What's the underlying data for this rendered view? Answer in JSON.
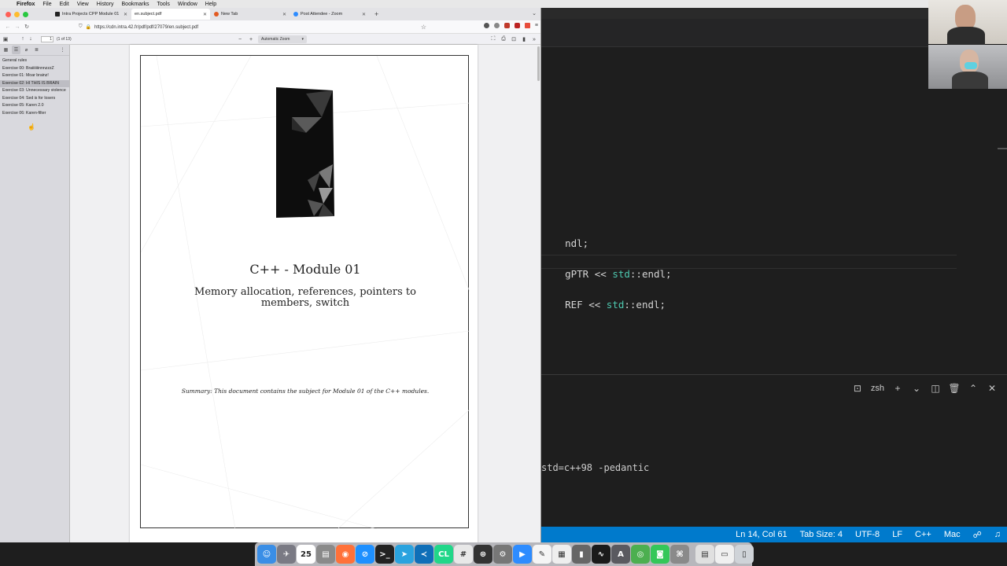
{
  "menubar": {
    "app_name": "Firefox",
    "items": [
      "File",
      "Edit",
      "View",
      "History",
      "Bookmarks",
      "Tools",
      "Window",
      "Help"
    ]
  },
  "browser": {
    "tabs": [
      {
        "label": "Intra Projects CPP Module 01",
        "active": false,
        "icon_color": "#222222"
      },
      {
        "label": "en.subject.pdf",
        "active": true,
        "icon_color": "#ffffff"
      },
      {
        "label": "New Tab",
        "active": false,
        "icon_color": "#e25920"
      },
      {
        "label": "Post Attendee - Zoom",
        "active": false,
        "icon_color": "#2d8cff"
      }
    ],
    "new_tab_label": "+",
    "url": "https://cdn.intra.42.fr/pdf/pdf/27079/en.subject.pdf"
  },
  "pdf_viewer": {
    "page_number": "1",
    "page_count": "(1 of 13)",
    "zoom_level": "Automatic Zoom",
    "outline": [
      {
        "label": "General rules",
        "highlighted": false
      },
      {
        "label": "Exercise 00: BraiiiiiiinnnzzzZ",
        "highlighted": false
      },
      {
        "label": "Exercise 01: Moar brainz!",
        "highlighted": false
      },
      {
        "label": "Exercise 02: HI THIS IS BRAIN",
        "highlighted": true
      },
      {
        "label": "Exercise 03: Unnecessary violence",
        "highlighted": false
      },
      {
        "label": "Exercise 04: Sed is for losers",
        "highlighted": false
      },
      {
        "label": "Exercise 05: Karen 2.0",
        "highlighted": false
      },
      {
        "label": "Exercise 06: Karen-filter",
        "highlighted": false
      }
    ],
    "document": {
      "title": "C++ - Module 01",
      "subtitle": "Memory allocation, references, pointers to members, switch",
      "summary": "Summary:  This document contains the subject for Module 01 of the C++ modules."
    }
  },
  "editor": {
    "code_lines": [
      {
        "prefix": "ndl;",
        "ns": "",
        "suffix": ""
      },
      {
        "prefix": "gPTR << ",
        "ns": "std",
        "suffix": "::endl;"
      },
      {
        "prefix": "REF << ",
        "ns": "std",
        "suffix": "::endl;"
      }
    ],
    "terminal": {
      "shell_name": "zsh",
      "command_line": "std=c++98 -pedantic"
    },
    "statusbar": {
      "position": "Ln 14, Col 61",
      "tab_size": "Tab Size: 4",
      "encoding": "UTF-8",
      "line_ending": "LF",
      "language": "C++",
      "platform": "Mac"
    }
  },
  "dock": {
    "calendar_day": "25",
    "apps": [
      {
        "name": "finder-icon",
        "color": "#3a8ee6",
        "glyph": "☺"
      },
      {
        "name": "launchpad-icon",
        "color": "#7a7a84",
        "glyph": "✈"
      },
      {
        "name": "calendar-icon",
        "color": "#ffffff",
        "glyph": ""
      },
      {
        "name": "notes-icon",
        "color": "#8a8a8a",
        "glyph": "▤"
      },
      {
        "name": "firefox-icon",
        "color": "#ff7139",
        "glyph": "◉"
      },
      {
        "name": "safari-icon",
        "color": "#1e90ff",
        "glyph": "⊘"
      },
      {
        "name": "terminal-icon",
        "color": "#222222",
        "glyph": ">_"
      },
      {
        "name": "telegram-icon",
        "color": "#2aa3df",
        "glyph": "➤"
      },
      {
        "name": "vscode-icon",
        "color": "#0f6fb8",
        "glyph": "≺"
      },
      {
        "name": "clion-icon",
        "color": "#21d789",
        "glyph": "CL"
      },
      {
        "name": "slack-icon",
        "color": "#e8e8e8",
        "glyph": "#"
      },
      {
        "name": "steam-icon",
        "color": "#333333",
        "glyph": "⊛"
      },
      {
        "name": "system-preferences-icon",
        "color": "#777777",
        "glyph": "⚙"
      },
      {
        "name": "zoom-icon",
        "color": "#2d8cff",
        "glyph": "▶"
      },
      {
        "name": "textedit-icon",
        "color": "#f5f5f5",
        "glyph": "✎"
      },
      {
        "name": "preview-icon",
        "color": "#eeeeee",
        "glyph": "▦"
      },
      {
        "name": "utility-icon",
        "color": "#666666",
        "glyph": "▮"
      },
      {
        "name": "activity-monitor-icon",
        "color": "#1a1a1a",
        "glyph": "∿"
      },
      {
        "name": "app-store-icon",
        "color": "#5a5a60",
        "glyph": "A"
      },
      {
        "name": "chrome-icon",
        "color": "#4caf50",
        "glyph": "◎"
      },
      {
        "name": "messages-icon",
        "color": "#34c759",
        "glyph": "◙"
      },
      {
        "name": "launcher-icon",
        "color": "#8a8a8a",
        "glyph": "⌘"
      }
    ],
    "trailing": [
      {
        "name": "documents-stack-icon",
        "color": "#e0e0e0",
        "glyph": "▤"
      },
      {
        "name": "downloads-stack-icon",
        "color": "#f0f0f0",
        "glyph": "▭"
      },
      {
        "name": "trash-icon",
        "color": "#cfd3d8",
        "glyph": "▯"
      }
    ]
  }
}
